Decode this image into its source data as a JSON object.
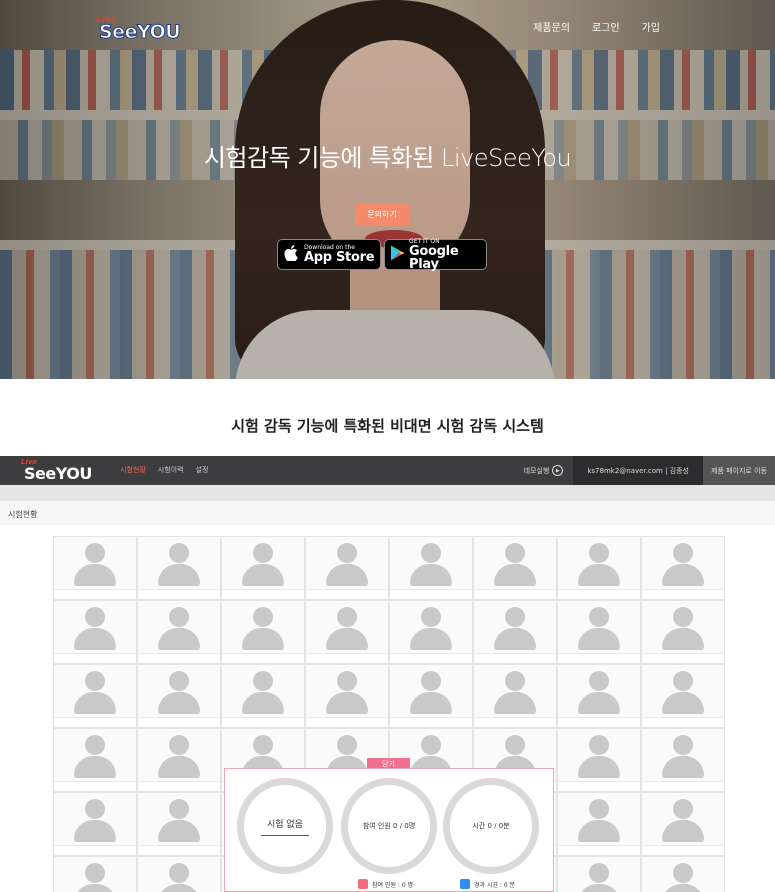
{
  "brand": {
    "logo_small": "Live",
    "logo_main": "SeeYOU"
  },
  "top_nav": [
    "제품문의",
    "로그인",
    "가입"
  ],
  "hero": {
    "title": "시험감독 기능에 특화된 LiveSeeYou",
    "cta": "문의하기",
    "app_store": {
      "small": "Download on the",
      "big": "App Store"
    },
    "google_play": {
      "small": "GET IT ON",
      "big": "Google Play"
    }
  },
  "section_title": "시험 감독 기능에 특화된 비대면 시험 감독 시스템",
  "app": {
    "nav": [
      "시험현황",
      "시험이력",
      "설정"
    ],
    "demo_label": "데모실행",
    "user": "ks78mk2@naver.com | 김종성",
    "goto": "제품 페이지로 이동",
    "page_title": "시험현황",
    "close_label": "닫기",
    "status": {
      "exam": "시험 없음",
      "participants": "참여 인원 0 / 0명",
      "time": "시간 0 / 0분"
    },
    "legend": [
      {
        "label": "참여 인원 : 0 명",
        "color": "#f36b7d"
      },
      {
        "label": "경과 시간 : 0 분",
        "color": "#2f8ff0"
      }
    ]
  },
  "colors": {
    "accent": "#f48a6a",
    "app_bar": "#3d3d3f",
    "active_nav": "#f36b5a"
  },
  "icons": [
    "apple-icon",
    "google-play-icon",
    "play-circle-icon",
    "avatar-placeholder-icon"
  ]
}
